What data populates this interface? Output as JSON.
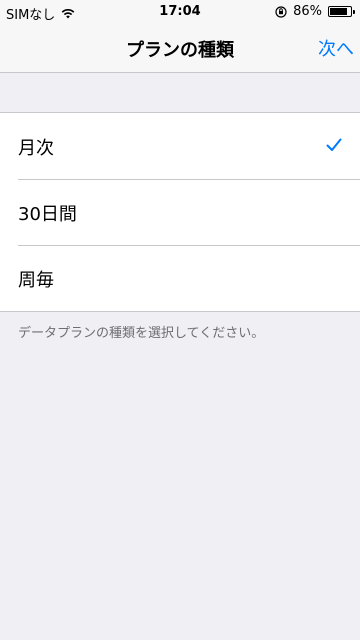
{
  "status": {
    "carrier": "SIMなし",
    "time": "17:04",
    "battery_percent": "86%",
    "battery_level": 0.86
  },
  "nav": {
    "title": "プランの種類",
    "next_label": "次へ"
  },
  "plans": [
    {
      "label": "月次",
      "selected": true
    },
    {
      "label": "30日間",
      "selected": false
    },
    {
      "label": "周毎",
      "selected": false
    }
  ],
  "footnote": "データプランの種類を選択してください。",
  "colors": {
    "accent": "#007aff",
    "background": "#efeff4",
    "separator": "#c8c7cc",
    "footnote": "#6d6d72"
  },
  "icons": {
    "wifi": "wifi-icon",
    "orientation_lock": "orientation-lock-icon",
    "battery": "battery-icon",
    "checkmark": "checkmark-icon"
  }
}
